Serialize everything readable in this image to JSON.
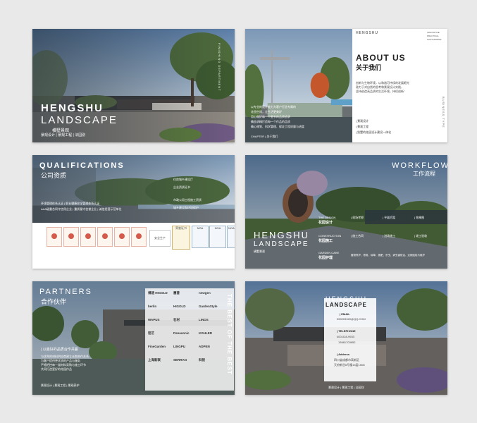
{
  "card1": {
    "title": "HENGSHU",
    "subtitle": "LANDSCAPE",
    "cn_name": "横墅景观",
    "tags": "景观设计 | 景观工程 | 法园别",
    "vertical": "FINISHING DEPARTMENT"
  },
  "card2": {
    "brand": "HENGSHU",
    "corner": [
      "INNOVATIVE",
      "PRACTICAL",
      "SUSTAINABLE"
    ],
    "about_en": "ABOUT US",
    "about_cn": "关于我们",
    "intro": [
      "创新与生物环境，以和谐可持续的发展眼光",
      "致力于对自然的思考和景观设计实践，",
      "坚持创造高品质的生活环境，持续创新\""
    ],
    "services": [
      "| 景观设计",
      "| 景观工程",
      "| 别墅的花园设计建设一体化"
    ],
    "overlay": [
      "以专业的设计能力为客户打造专属的",
      "花园空间，让生活更美好",
      "用心做好每一个细节的品质追求",
      "精益求精打造每一个作品的品质",
      "精心规划、科学管理、保证工程质量与进度"
    ],
    "chapter": "CHAPTER | 关于我们",
    "vertical": "BUSINESS TYPE"
  },
  "card3": {
    "title_en": "QUALIFICATIONS",
    "title_cn": "公司资质",
    "lines": [
      "环境管理体系认证 | 职业健康安全管理体系认证",
      "AAA级重合同守信用企业 | 重质量守信誉企业 | 诚信经营示范单位"
    ],
    "lines_right": [
      "住房城乡建设厅",
      "企业资质证书",
      "市政公用工程施工资质",
      "城乡建设和环境保护"
    ],
    "certs": [
      "NOA",
      "NOA",
      "NOA",
      "安全生产",
      "荣誉证书"
    ]
  },
  "card4": {
    "title_en": "WORKFLOW",
    "title_cn": "工作流程",
    "brand": "HENGSHU",
    "brand_sub": "LANDSCAPE",
    "brand_cn": "横墅景观",
    "steps": [
      {
        "en": "THE DESIGN",
        "cn": "花园设计",
        "cols": [
          "| 现场考察",
          "| 平面方案",
          "| 效果图"
        ]
      },
      {
        "en": "CONSTRUCTION",
        "cn": "花园施工",
        "cols": [
          "| 施工合同",
          "| 进场施工",
          "| 竣工验收"
        ]
      },
      {
        "en": "GARDEN CARE",
        "cn": "花园护理",
        "cols": [
          "植物养护、修剪、除草、施肥、杀虫、病虫害防治、定期巡检与维护"
        ]
      }
    ]
  },
  "card5": {
    "title_en": "PARTNERS",
    "title_cn": "合作伙伴",
    "slogan": "| 以最好的品质合作共赢",
    "body": [
      "与优秀的材料供应商建立长期合作关系",
      "为客户提供更优质的产品与服务",
      "严格把控每一道材料采购与施工环节",
      "共同打造更好的花园作品"
    ],
    "tags": "景观设计 | 景观工程 | 景观养护",
    "logos": [
      "博涵 HIGOLD",
      "惠普",
      "newgen",
      "berlin",
      "HIGOLD",
      "GardenStyle",
      "WAPUS",
      "石材",
      "LINOS",
      "铝艺",
      "Panasonic",
      "KOHLER",
      "FineGarden",
      "LINGPU",
      "ADPEN",
      "上海新联",
      "SERRAN",
      "科锐"
    ],
    "vertical": "THE BEST OF THE BEST"
  },
  "card6": {
    "brand": "HENGSHU",
    "brand_sub": "LANDSCAPE",
    "email_label": "| EMAIL",
    "email": "359203320@QQ.COM",
    "phone_label": "| TELEPHONE",
    "phone1": "400-028-9933",
    "phone2": "13981703952",
    "address_label": "| Address",
    "address1": "四川省成都市高新区",
    "address2": "天府新谷6号楼15层1508",
    "tags": "景观设计 | 景观工程 | 法园别"
  }
}
